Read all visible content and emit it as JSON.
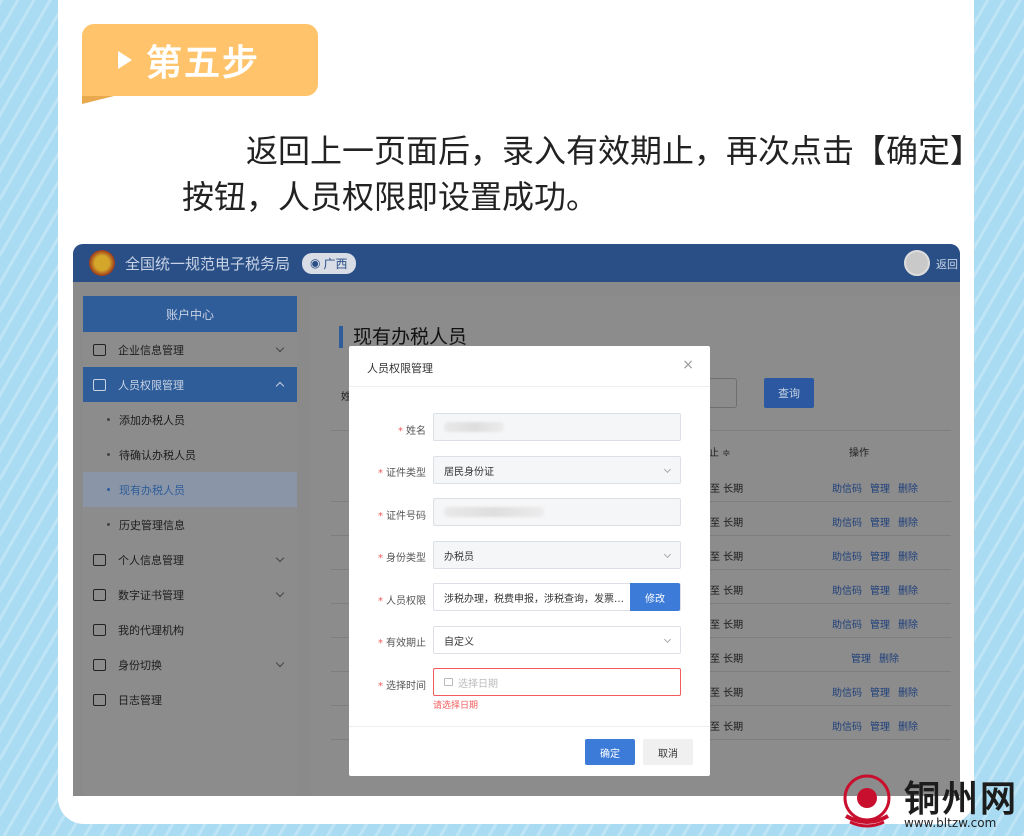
{
  "step": {
    "label": "第五步"
  },
  "instruction": "返回上一页面后，录入有效期止，再次点击【确定】按钮，人员权限即设置成功。",
  "app": {
    "site_name": "全国统一规范电子税务局",
    "region": "广西",
    "back_label": "返回"
  },
  "sidebar": {
    "header": "账户中心",
    "items": [
      {
        "label": "企业信息管理",
        "type": "group"
      },
      {
        "label": "人员权限管理",
        "type": "group",
        "expanded": true
      },
      {
        "label": "添加办税人员",
        "type": "sub"
      },
      {
        "label": "待确认办税人员",
        "type": "sub"
      },
      {
        "label": "现有办税人员",
        "type": "sub",
        "current": true
      },
      {
        "label": "历史管理信息",
        "type": "sub"
      },
      {
        "label": "个人信息管理",
        "type": "group"
      },
      {
        "label": "数字证书管理",
        "type": "group"
      },
      {
        "label": "我的代理机构",
        "type": "item"
      },
      {
        "label": "身份切换",
        "type": "group"
      },
      {
        "label": "日志管理",
        "type": "item"
      }
    ]
  },
  "main": {
    "title": "现有办税人员",
    "query_button": "查询",
    "filter_label_start": "姓",
    "col_expiry": "止 ≑",
    "col_ops": "操作",
    "rows": [
      {
        "expiry": "至 长期",
        "ops": [
          "助信码",
          "管理",
          "删除"
        ]
      },
      {
        "expiry": "至 长期",
        "ops": [
          "助信码",
          "管理",
          "删除"
        ]
      },
      {
        "expiry": "至 长期",
        "ops": [
          "助信码",
          "管理",
          "删除"
        ]
      },
      {
        "expiry": "至 长期",
        "ops": [
          "助信码",
          "管理",
          "删除"
        ]
      },
      {
        "expiry": "至 长期",
        "ops": [
          "助信码",
          "管理",
          "删除"
        ]
      },
      {
        "expiry": "至 长期",
        "ops": [
          "管理",
          "删除"
        ]
      },
      {
        "expiry": "至 长期",
        "ops": [
          "助信码",
          "管理",
          "删除"
        ]
      },
      {
        "expiry": "至 长期",
        "ops": [
          "助信码",
          "管理",
          "删除"
        ]
      }
    ]
  },
  "modal": {
    "title": "人员权限管理",
    "close": "×",
    "fields": {
      "name_label": "姓名",
      "id_type_label": "证件类型",
      "id_type_value": "居民身份证",
      "id_number_label": "证件号码",
      "identity_label": "身份类型",
      "identity_value": "办税员",
      "permission_label": "人员权限",
      "permission_value": "涉税办理，税费申报，涉税查询，发票…",
      "modify_button": "修改",
      "expiry_label": "有效期止",
      "expiry_value": "自定义",
      "time_label": "选择时间",
      "time_placeholder": "选择日期",
      "error": "请选择日期"
    },
    "ok_button": "确定",
    "cancel_button": "取消"
  },
  "watermark": {
    "name": "铜州网",
    "url": "www.bltzw.com"
  }
}
